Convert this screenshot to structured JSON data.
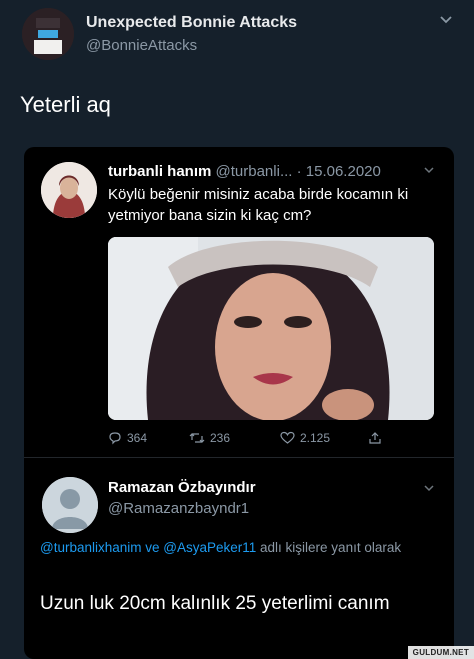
{
  "tweet": {
    "display_name": "Unexpected Bonnie Attacks",
    "handle": "@BonnieAttacks",
    "text": "Yeterli aq"
  },
  "quoted": {
    "name": "turbanli hanım",
    "handle_date": "@turbanli... · 15.06.2020",
    "text": "Köylü beğenir misiniz acaba birde kocamın ki yetmiyor bana sizin ki kaç cm?",
    "replies": "364",
    "retweets": "236",
    "likes": "2.125"
  },
  "reply": {
    "name": "Ramazan Özbayındır",
    "handle": "@Ramazanzbayndr1",
    "mentions": "@turbanlixhanim ve @AsyaPeker11",
    "context": "adlı kişilere yanıt olarak",
    "text": "Uzun luk 20cm kalınlık 25 yeterlimi canım"
  },
  "watermark": "GULDUM.NET",
  "colors": {
    "background": "#15202b",
    "card": "#000000",
    "link": "#1d9bf0",
    "muted": "#8b98a5"
  }
}
